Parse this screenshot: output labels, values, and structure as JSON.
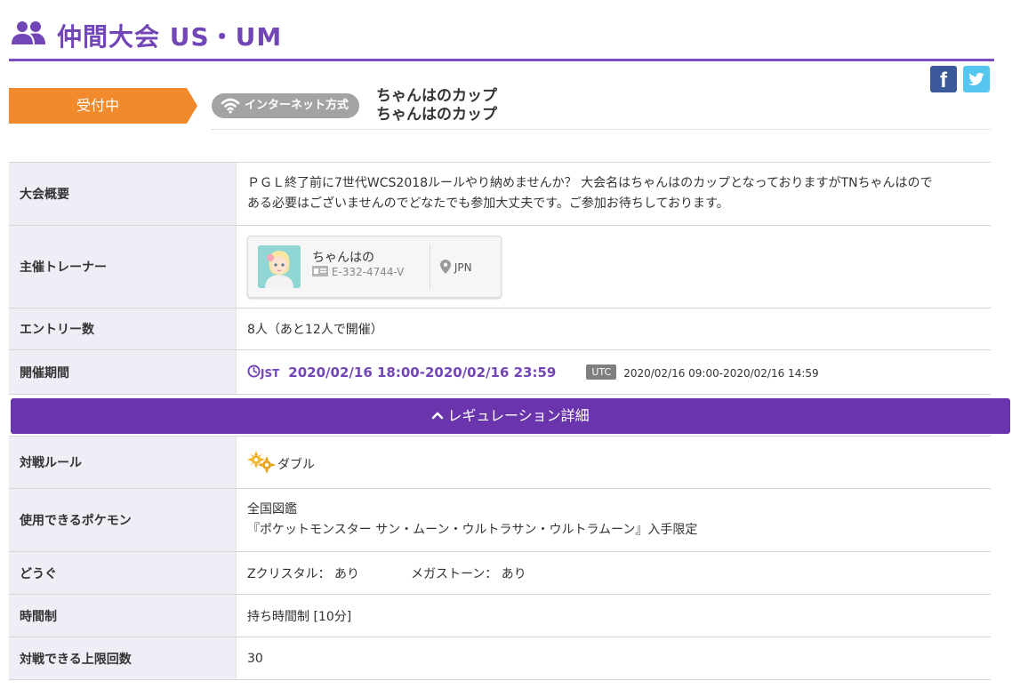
{
  "header": {
    "title": "仲間大会 US・UM"
  },
  "social": {
    "facebook": "f"
  },
  "tournament": {
    "status": "受付中",
    "connection": "インターネット方式",
    "name_line1": "ちゃんはのカップ",
    "name_line2": "ちゃんはのカップ"
  },
  "info": {
    "overview_label": "大会概要",
    "overview_line1": "ＰＧＬ終了前に7世代WCS2018ルールやり納めませんか？ 大会名はちゃんはのカップとなっておりますがTNちゃんはので",
    "overview_line2": "ある必要はございませんのでどなたでも参加大丈夫です。ご参加お待ちしております。",
    "organizer_label": "主催トレーナー",
    "trainer_name": "ちゃんはの",
    "trainer_id": "E-332-4744-V",
    "trainer_country": "JPN",
    "entries_label": "エントリー数",
    "entries_value": "8人（あと12人で開催）",
    "period_label": "開催期間",
    "jst_label": "JST",
    "jst_period": "2020/02/16 18:00-2020/02/16 23:59",
    "utc_label": "UTC",
    "utc_period": "2020/02/16 09:00-2020/02/16 14:59"
  },
  "regulation": {
    "toggle_label": "レギュレーション詳細",
    "battle_rule_label": "対戦ルール",
    "battle_rule_value": "ダブル",
    "pokemon_label": "使用できるポケモン",
    "pokemon_line1": "全国図鑑",
    "pokemon_line2": "『ポケットモンスター サン・ムーン・ウルトラサン・ウルトラムーン』入手限定",
    "items_label": "どうぐ",
    "zcrystal": "Zクリスタル： あり",
    "megastone": "メガストーン： あり",
    "time_label": "時間制",
    "time_value": "持ち時間制 [10分]",
    "max_battles_label": "対戦できる上限回数",
    "max_battles_value": "30"
  },
  "colors": {
    "accent": "#7346b8",
    "status": "#f08a2c",
    "reg_bar": "#6a34ad"
  },
  "icons": [
    "people-icon",
    "facebook-icon",
    "twitter-icon",
    "wifi-icon",
    "id-card-icon",
    "location-pin-icon",
    "clock-icon",
    "chevron-up-icon",
    "double-battle-icon"
  ]
}
